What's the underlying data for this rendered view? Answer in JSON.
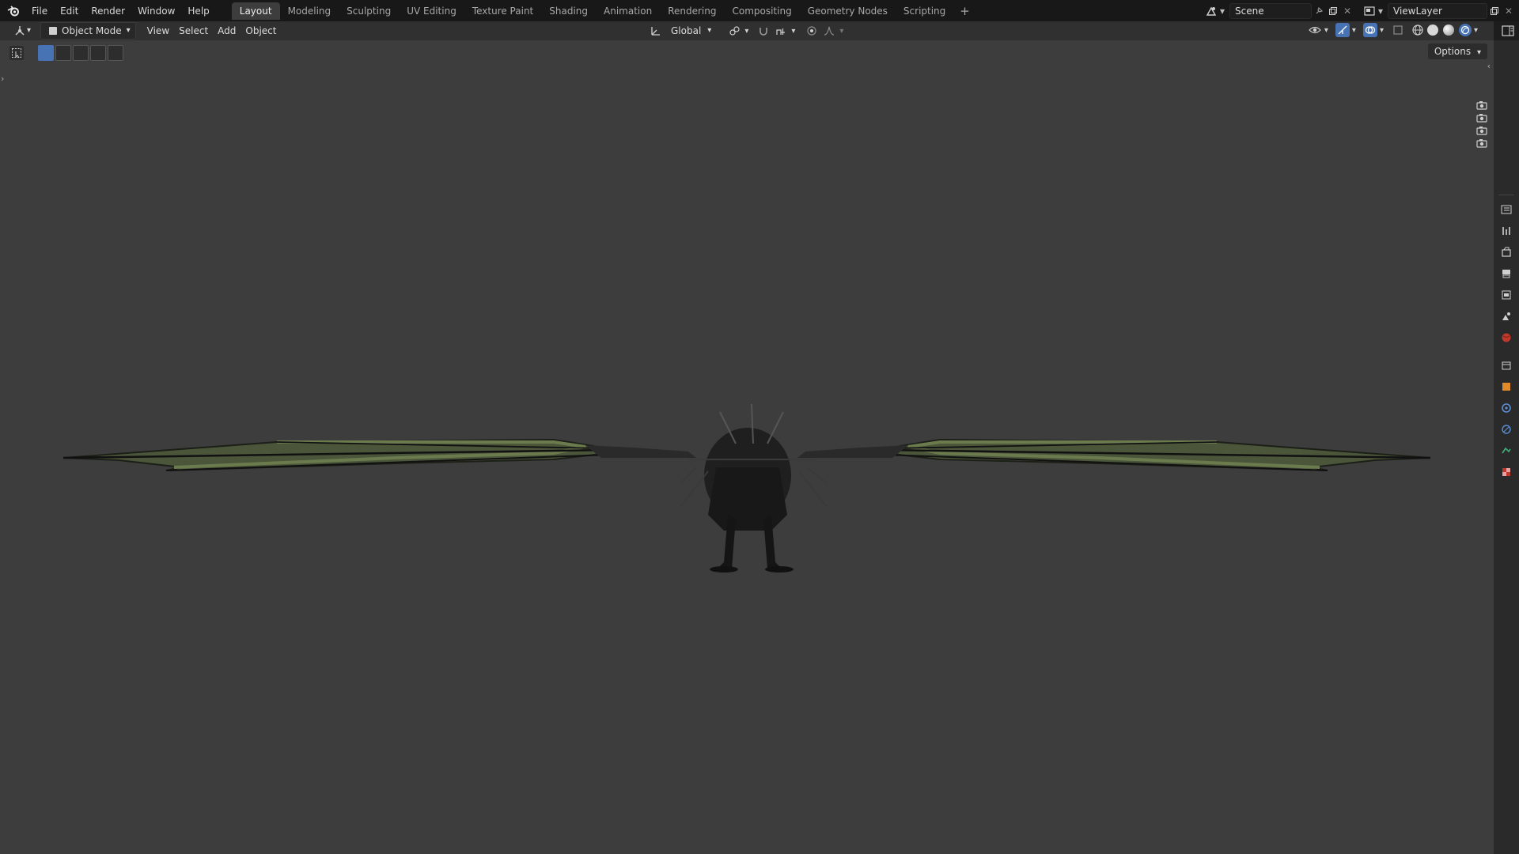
{
  "topbar": {
    "menus": [
      "File",
      "Edit",
      "Render",
      "Window",
      "Help"
    ],
    "workspaces": [
      "Layout",
      "Modeling",
      "Sculpting",
      "UV Editing",
      "Texture Paint",
      "Shading",
      "Animation",
      "Rendering",
      "Compositing",
      "Geometry Nodes",
      "Scripting"
    ],
    "active_workspace": "Layout",
    "add_tab": "+",
    "scene_name": "Scene",
    "view_layer_name": "ViewLayer"
  },
  "header": {
    "mode": "Object Mode",
    "menus": [
      "View",
      "Select",
      "Add",
      "Object"
    ],
    "transform_orientation": "Global"
  },
  "viewport": {
    "options_label": "Options"
  },
  "colors": {
    "accent": "#4772b3",
    "viewport_bg": "#3d3d3d",
    "wing_membrane": "#5b6b45"
  }
}
